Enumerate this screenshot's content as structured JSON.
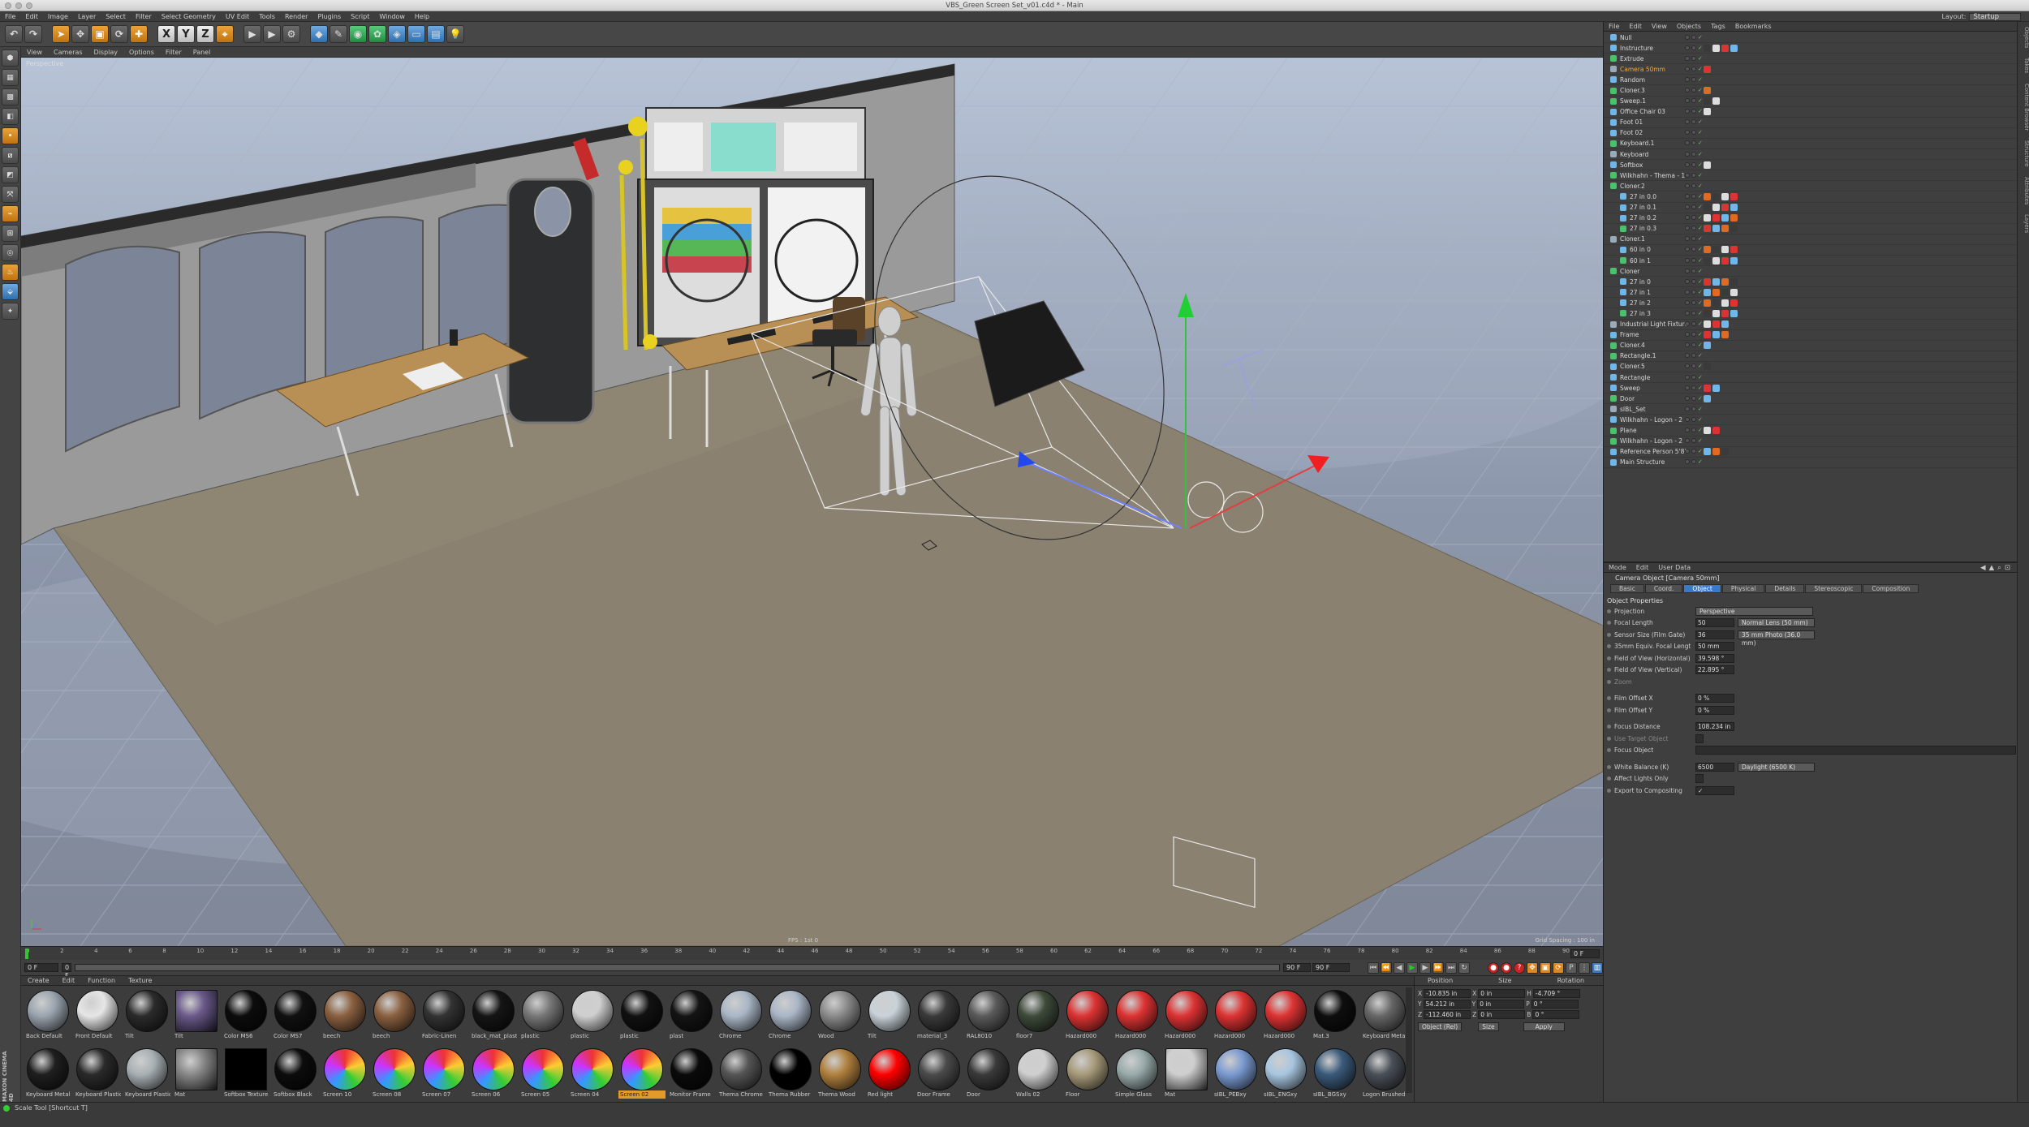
{
  "window": {
    "title": "VBS_Green Screen Set_v01.c4d * - Main"
  },
  "layout": {
    "label": "Layout:",
    "value": "Startup"
  },
  "menubar": [
    "File",
    "Edit",
    "Image",
    "Layer",
    "Select",
    "Filter",
    "Select Geometry",
    "UV Edit",
    "Tools",
    "Render",
    "Plugins",
    "Script",
    "Window",
    "Help"
  ],
  "toolbar": {
    "xyz": [
      "X",
      "Y",
      "Z"
    ]
  },
  "viewport": {
    "menu": [
      "View",
      "Cameras",
      "Display",
      "Options",
      "Filter",
      "Panel"
    ],
    "label": "Perspective",
    "fps": "FPS : 1st 0",
    "grid_spacing": "Grid Spacing : 100 in"
  },
  "timeline": {
    "ticks": [
      "0",
      "2",
      "4",
      "6",
      "8",
      "10",
      "12",
      "14",
      "16",
      "18",
      "20",
      "22",
      "24",
      "26",
      "28",
      "30",
      "32",
      "34",
      "36",
      "38",
      "40",
      "42",
      "44",
      "46",
      "48",
      "50",
      "52",
      "54",
      "56",
      "58",
      "60",
      "62",
      "64",
      "66",
      "68",
      "70",
      "72",
      "74",
      "76",
      "78",
      "80",
      "82",
      "84",
      "86",
      "88",
      "90"
    ],
    "end_frame": "0 F",
    "start_field": "0 F",
    "min_field": "0 F",
    "max_field": "90 F",
    "max2_field": "90 F"
  },
  "materials": {
    "menu": [
      "Create",
      "Edit",
      "Function",
      "Texture"
    ],
    "row1": [
      "Back Default",
      "Front Default",
      "Tilt",
      "Tilt",
      "Color MS6",
      "Color MS7",
      "beech",
      "beech",
      "Fabric-Linen",
      "black_mat_plast",
      "plastic",
      "plastic",
      "plastic",
      "plast",
      "Chrome",
      "Chrome",
      "Wood",
      "Tilt",
      "material_3",
      "RAL8010",
      "floor7",
      "Hazard000",
      "Hazard000",
      "Hazard000",
      "Hazard000",
      "Hazard000",
      "Mat.3",
      "Keyboard Metal"
    ],
    "row2": [
      "Keyboard Metal",
      "Keyboard Plastic",
      "Keyboard Plastic",
      "Mat",
      "Softbox Texture",
      "Softbox Black",
      "Screen 10",
      "Screen 08",
      "Screen 07",
      "Screen 06",
      "Screen 05",
      "Screen 04",
      "Screen 02",
      "Monitor Frame",
      "Thema Chrome",
      "Thema Rubber",
      "Thema Wood",
      "Red light",
      "Door Frame",
      "Door",
      "Walls 02",
      "Floor",
      "Simple Glass",
      "Mat",
      "sIBL_PEBxy",
      "sIBL_ENGxy",
      "sIBL_BGSxy",
      "Logon Brushed"
    ],
    "selected": "Screen 02"
  },
  "coordinates": {
    "headers": [
      "Position",
      "Size",
      "Rotation"
    ],
    "rows": [
      {
        "axis": "X",
        "pos": "-10.835 in",
        "size_axis": "X",
        "size": "0 in",
        "rot_axis": "H",
        "rot": "-4.709 °"
      },
      {
        "axis": "Y",
        "pos": "54.212 in",
        "size_axis": "Y",
        "size": "0 in",
        "rot_axis": "P",
        "rot": "0 °"
      },
      {
        "axis": "Z",
        "pos": "-112.460 in",
        "size_axis": "Z",
        "size": "0 in",
        "rot_axis": "B",
        "rot": "0 °"
      }
    ],
    "mode": "Object (Rel)",
    "size_mode": "Size",
    "apply": "Apply"
  },
  "status": {
    "text": "Scale Tool [Shortcut T]",
    "brand": "MAXON CINEMA 4D"
  },
  "objects": {
    "menu": [
      "File",
      "Edit",
      "View",
      "Objects",
      "Tags",
      "Bookmarks"
    ],
    "items": [
      {
        "name": "Null",
        "depth": 0,
        "hl": false
      },
      {
        "name": "Instructure",
        "depth": 0,
        "hl": false
      },
      {
        "name": "Extrude",
        "depth": 0,
        "hl": false
      },
      {
        "name": "Camera 50mm",
        "depth": 0,
        "hl": true
      },
      {
        "name": "Random",
        "depth": 0,
        "hl": false
      },
      {
        "name": "Cloner.3",
        "depth": 0,
        "hl": false
      },
      {
        "name": "Sweep.1",
        "depth": 0,
        "hl": false
      },
      {
        "name": "Office Chair 03",
        "depth": 0,
        "hl": false
      },
      {
        "name": "Foot 01",
        "depth": 0,
        "hl": false
      },
      {
        "name": "Foot 02",
        "depth": 0,
        "hl": false
      },
      {
        "name": "Keyboard.1",
        "depth": 0,
        "hl": false
      },
      {
        "name": "Keyboard",
        "depth": 0,
        "hl": false
      },
      {
        "name": "Softbox",
        "depth": 0,
        "hl": false
      },
      {
        "name": "Wilkhahn - Thema - 1",
        "depth": 0,
        "hl": false
      },
      {
        "name": "Cloner.2",
        "depth": 0,
        "hl": false
      },
      {
        "name": "27 in 0.0",
        "depth": 1,
        "hl": false
      },
      {
        "name": "27 in 0.1",
        "depth": 1,
        "hl": false
      },
      {
        "name": "27 in 0.2",
        "depth": 1,
        "hl": false
      },
      {
        "name": "27 in 0.3",
        "depth": 1,
        "hl": false
      },
      {
        "name": "Cloner.1",
        "depth": 0,
        "hl": false
      },
      {
        "name": "60 in 0",
        "depth": 1,
        "hl": false
      },
      {
        "name": "60 in 1",
        "depth": 1,
        "hl": false
      },
      {
        "name": "Cloner",
        "depth": 0,
        "hl": false
      },
      {
        "name": "27 in 0",
        "depth": 1,
        "hl": false
      },
      {
        "name": "27 in 1",
        "depth": 1,
        "hl": false
      },
      {
        "name": "27 in 2",
        "depth": 1,
        "hl": false
      },
      {
        "name": "27 in 3",
        "depth": 1,
        "hl": false
      },
      {
        "name": "Industrial Light Fixture",
        "depth": 0,
        "hl": false
      },
      {
        "name": "Frame",
        "depth": 0,
        "hl": false
      },
      {
        "name": "Cloner.4",
        "depth": 0,
        "hl": false
      },
      {
        "name": "Rectangle.1",
        "depth": 0,
        "hl": false
      },
      {
        "name": "Cloner.5",
        "depth": 0,
        "hl": false
      },
      {
        "name": "Rectangle",
        "depth": 0,
        "hl": false
      },
      {
        "name": "Sweep",
        "depth": 0,
        "hl": false
      },
      {
        "name": "Door",
        "depth": 0,
        "hl": false
      },
      {
        "name": "sIBL_Set",
        "depth": 0,
        "hl": false
      },
      {
        "name": "Wilkhahn - Logon - 2",
        "depth": 0,
        "hl": false
      },
      {
        "name": "Plane",
        "depth": 0,
        "hl": false
      },
      {
        "name": "Wilkhahn - Logon - 2",
        "depth": 0,
        "hl": false
      },
      {
        "name": "Reference Person 5'8\"",
        "depth": 0,
        "hl": false
      },
      {
        "name": "Main Structure",
        "depth": 0,
        "hl": false
      }
    ]
  },
  "attributes": {
    "menu": [
      "Mode",
      "Edit",
      "User Data"
    ],
    "title": "Camera Object [Camera 50mm]",
    "tabs": [
      "Basic",
      "Coord.",
      "Object",
      "Physical",
      "Details",
      "Stereoscopic",
      "Composition"
    ],
    "active_tab": "Object",
    "section": "Object Properties",
    "rows": [
      {
        "label": "Projection",
        "value": "",
        "drop": "Perspective",
        "dim": false
      },
      {
        "label": "Focal Length",
        "value": "50",
        "drop": "Normal Lens (50 mm)",
        "dim": false
      },
      {
        "label": "Sensor Size (Film Gate)",
        "value": "36",
        "drop": "35 mm Photo (36.0 mm)",
        "dim": false
      },
      {
        "label": "35mm Equiv. Focal Length:",
        "value": "50 mm",
        "drop": "",
        "dim": false
      },
      {
        "label": "Field of View (Horizontal)",
        "value": "39.598 °",
        "drop": "",
        "dim": false
      },
      {
        "label": "Field of View (Vertical)",
        "value": "22.895 °",
        "drop": "",
        "dim": false
      },
      {
        "label": "Zoom",
        "value": "",
        "drop": "",
        "dim": true
      },
      {
        "label": "Film Offset X",
        "value": "0 %",
        "drop": "",
        "dim": false
      },
      {
        "label": "Film Offset Y",
        "value": "0 %",
        "drop": "",
        "dim": false
      },
      {
        "label": "Focus Distance",
        "value": "108.234 in",
        "drop": "",
        "dim": false
      },
      {
        "label": "Use Target Object",
        "value": "",
        "drop": "",
        "dim": true
      },
      {
        "label": "Focus Object",
        "value": "",
        "drop": "",
        "dim": false
      },
      {
        "label": "White Balance (K)",
        "value": "6500",
        "drop": "Daylight (6500 K)",
        "dim": false
      },
      {
        "label": "Affect Lights Only",
        "value": "",
        "drop": "",
        "dim": false
      },
      {
        "label": "Export to Compositing",
        "value": "✓",
        "drop": "",
        "dim": false
      }
    ]
  },
  "rightstrip": [
    "Objects",
    "Takes",
    "Content Browser",
    "Structure",
    "Attributes",
    "Layers"
  ]
}
